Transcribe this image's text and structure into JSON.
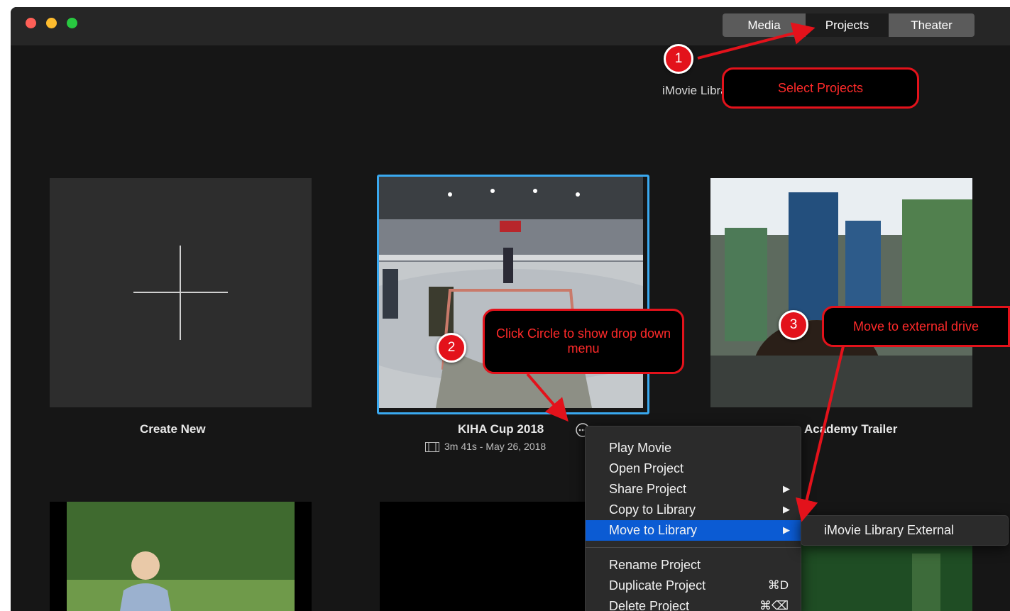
{
  "tabs": [
    {
      "label": "Media",
      "active": false
    },
    {
      "label": "Projects",
      "active": true
    },
    {
      "label": "Theater",
      "active": false
    }
  ],
  "library_title": "iMovie Library",
  "projects": [
    {
      "title": "Create New"
    },
    {
      "title": "KIHA Cup 2018",
      "meta": "3m 41s - May 26, 2018",
      "selected": true
    },
    {
      "title": "Academy Trailer"
    }
  ],
  "context_menu": {
    "items": [
      {
        "label": "Play Movie",
        "submenu": false,
        "shortcut": ""
      },
      {
        "label": "Open Project",
        "submenu": false,
        "shortcut": ""
      },
      {
        "label": "Share Project",
        "submenu": true,
        "shortcut": ""
      },
      {
        "label": "Copy to Library",
        "submenu": true,
        "shortcut": ""
      },
      {
        "label": "Move to Library",
        "submenu": true,
        "shortcut": "",
        "highlighted": true
      },
      {
        "label": "Rename Project",
        "submenu": false,
        "shortcut": ""
      },
      {
        "label": "Duplicate Project",
        "submenu": false,
        "shortcut": "⌘D"
      },
      {
        "label": "Delete Project",
        "submenu": false,
        "shortcut": "⌘⌫"
      }
    ],
    "submenu_item": "iMovie Library External"
  },
  "annotations": [
    {
      "number": "1",
      "text": "Select Projects"
    },
    {
      "number": "2",
      "text": "Click Circle to show drop down menu"
    },
    {
      "number": "3",
      "text": "Move to external drive"
    }
  ],
  "colors": {
    "accent": "#0b5bd3",
    "selection_border": "#3aa9f0",
    "annotation_red": "#e3121b",
    "traffic_red": "#fe5f57",
    "traffic_yellow": "#febc2e",
    "traffic_green": "#28c840"
  },
  "icons": {
    "more": "ellipsis-circle-icon",
    "film": "film-strip-icon",
    "plus": "plus-icon",
    "submenu": "chevron-right-icon"
  }
}
